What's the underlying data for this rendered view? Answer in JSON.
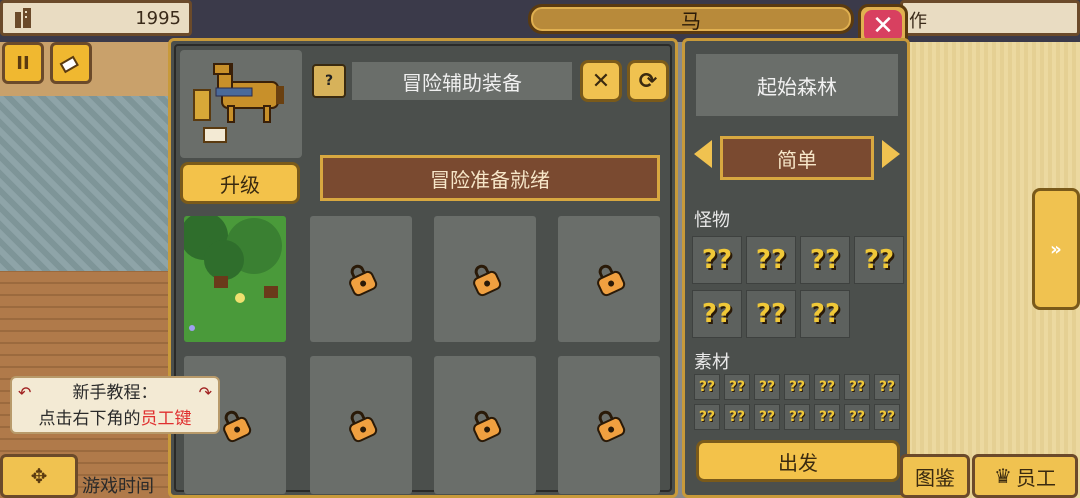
{
  "hud": {
    "year": "1995",
    "right_text": "作"
  },
  "dialog": {
    "title": "马",
    "upgrade_label": "升级",
    "equip_label": "冒险辅助装备",
    "status_text": "冒险准备就绪"
  },
  "location": {
    "name": "起始森林",
    "difficulty": "简单",
    "monsters_label": "怪物",
    "materials_label": "素材",
    "go_label": "出发"
  },
  "tutorial": {
    "line1": "新手教程：",
    "line2_prefix": "点击右下角的",
    "line2_highlight": "员工",
    "line2_suffix": "键"
  },
  "bottom": {
    "game_time_label": "游戏时间",
    "encyclopedia_label": "图鉴",
    "staff_label": "员工"
  },
  "colors": {
    "panel_bg": "#4b4f4c",
    "gold_border": "#c89a3a",
    "button_yellow": "#f3c24a",
    "status_brown": "#7a4a30",
    "close_red": "#d84060"
  }
}
